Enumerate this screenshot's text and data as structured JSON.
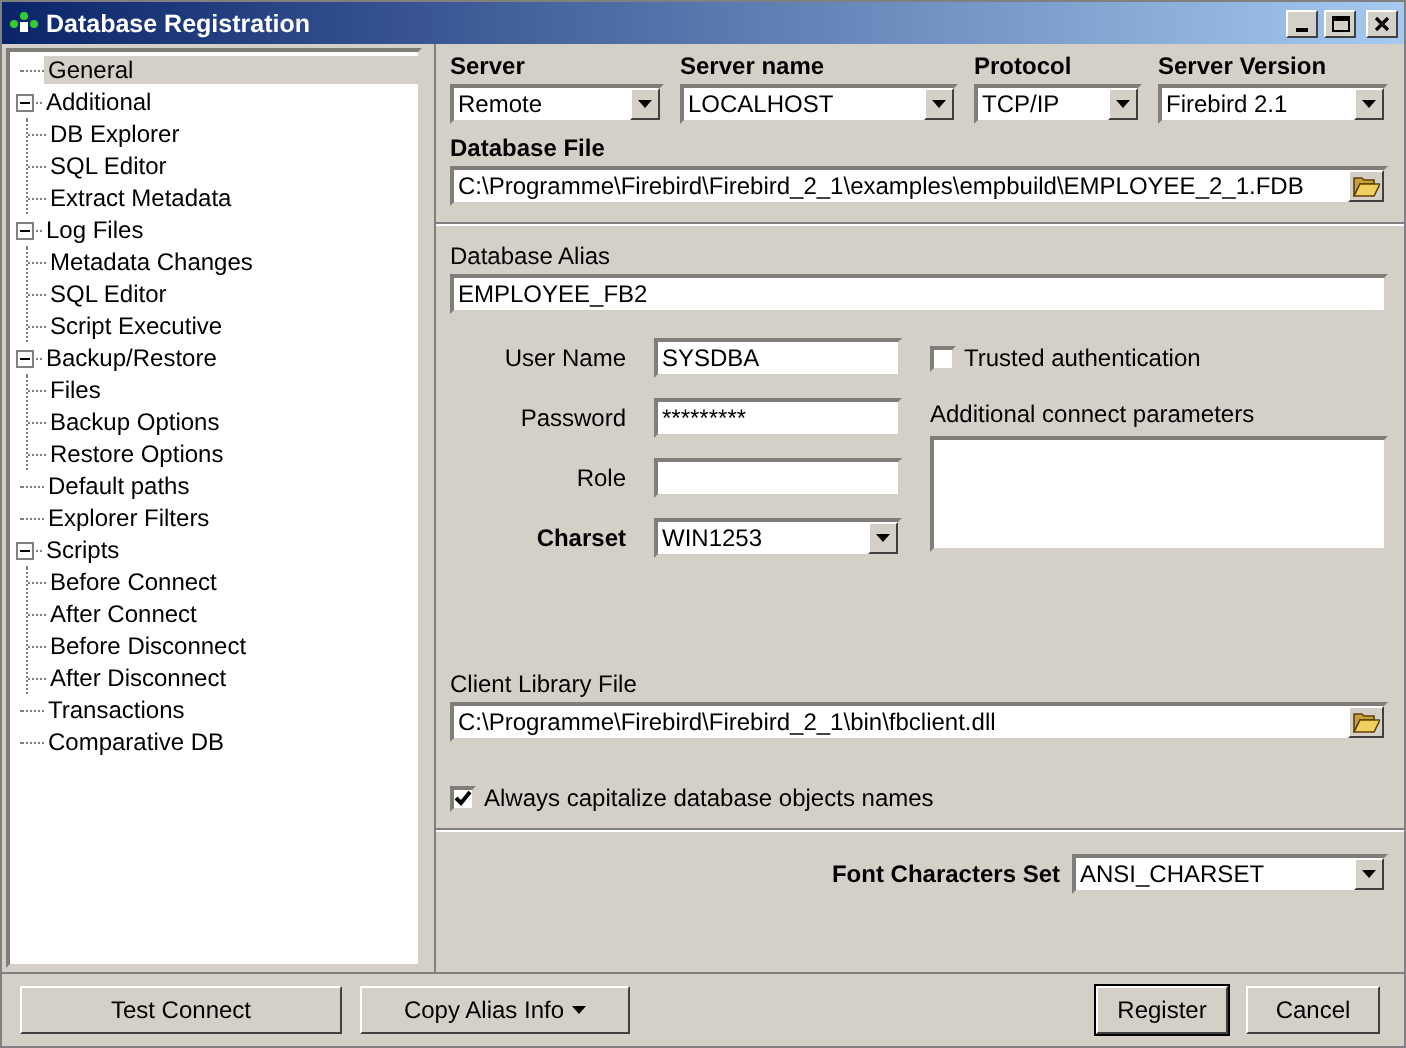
{
  "window": {
    "title": "Database Registration"
  },
  "tree": [
    {
      "label": "General",
      "selected": true
    },
    {
      "label": "Additional",
      "selected": false,
      "expanded": true,
      "children": [
        {
          "label": "DB Explorer",
          "selected": false
        },
        {
          "label": "SQL Editor",
          "selected": false
        },
        {
          "label": "Extract Metadata",
          "selected": false
        }
      ]
    },
    {
      "label": "Log Files",
      "selected": false,
      "expanded": true,
      "children": [
        {
          "label": "Metadata Changes",
          "selected": false
        },
        {
          "label": "SQL Editor",
          "selected": false
        },
        {
          "label": "Script Executive",
          "selected": false
        }
      ]
    },
    {
      "label": "Backup/Restore",
      "selected": false,
      "expanded": true,
      "children": [
        {
          "label": "Files",
          "selected": false
        },
        {
          "label": "Backup Options",
          "selected": false
        },
        {
          "label": "Restore Options",
          "selected": false
        }
      ]
    },
    {
      "label": "Default paths",
      "selected": false
    },
    {
      "label": "Explorer Filters",
      "selected": false
    },
    {
      "label": "Scripts",
      "selected": false,
      "expanded": true,
      "children": [
        {
          "label": "Before Connect",
          "selected": false
        },
        {
          "label": "After Connect",
          "selected": false
        },
        {
          "label": "Before Disconnect",
          "selected": false
        },
        {
          "label": "After Disconnect",
          "selected": false
        }
      ]
    },
    {
      "label": "Transactions",
      "selected": false
    },
    {
      "label": "Comparative DB",
      "selected": false
    }
  ],
  "server": [
    {
      "label": "Server",
      "value": "Remote"
    },
    {
      "label": "Server name",
      "value": "LOCALHOST"
    },
    {
      "label": "Protocol",
      "value": "TCP/IP"
    },
    {
      "label": "Server Version",
      "value": "Firebird 2.1"
    }
  ],
  "database_file": {
    "label": "Database File",
    "value": "C:\\Programme\\Firebird\\Firebird_2_1\\examples\\empbuild\\EMPLOYEE_2_1.FDB"
  },
  "database_alias": {
    "label": "Database Alias",
    "value": "EMPLOYEE_FB2"
  },
  "login": [
    {
      "kind": "text",
      "label": "User Name",
      "value": "SYSDBA"
    },
    {
      "kind": "text",
      "label": "Password",
      "value": "*********"
    },
    {
      "kind": "text",
      "label": "Role"
    },
    {
      "kind": "combo",
      "label": "Charset",
      "value": "WIN1253"
    }
  ],
  "trusted_authentication": {
    "label": "Trusted authentication",
    "checked": false
  },
  "additional_parameters": {
    "label": "Additional connect parameters"
  },
  "client_library": {
    "label": "Client Library File",
    "value": "C:\\Programme\\Firebird\\Firebird_2_1\\bin\\fbclient.dll"
  },
  "capitalize_names": {
    "label": "Always capitalize database objects names",
    "checked": true
  },
  "font_characters_set": {
    "label": "Font Characters Set",
    "value": "ANSI_CHARSET"
  },
  "buttons_left": [
    {
      "label": "Test Connect",
      "dropdown": false
    },
    {
      "label": "Copy Alias Info",
      "dropdown": true
    }
  ],
  "buttons_right": [
    {
      "label": "Register",
      "default": true
    },
    {
      "label": "Cancel",
      "default": false
    }
  ]
}
